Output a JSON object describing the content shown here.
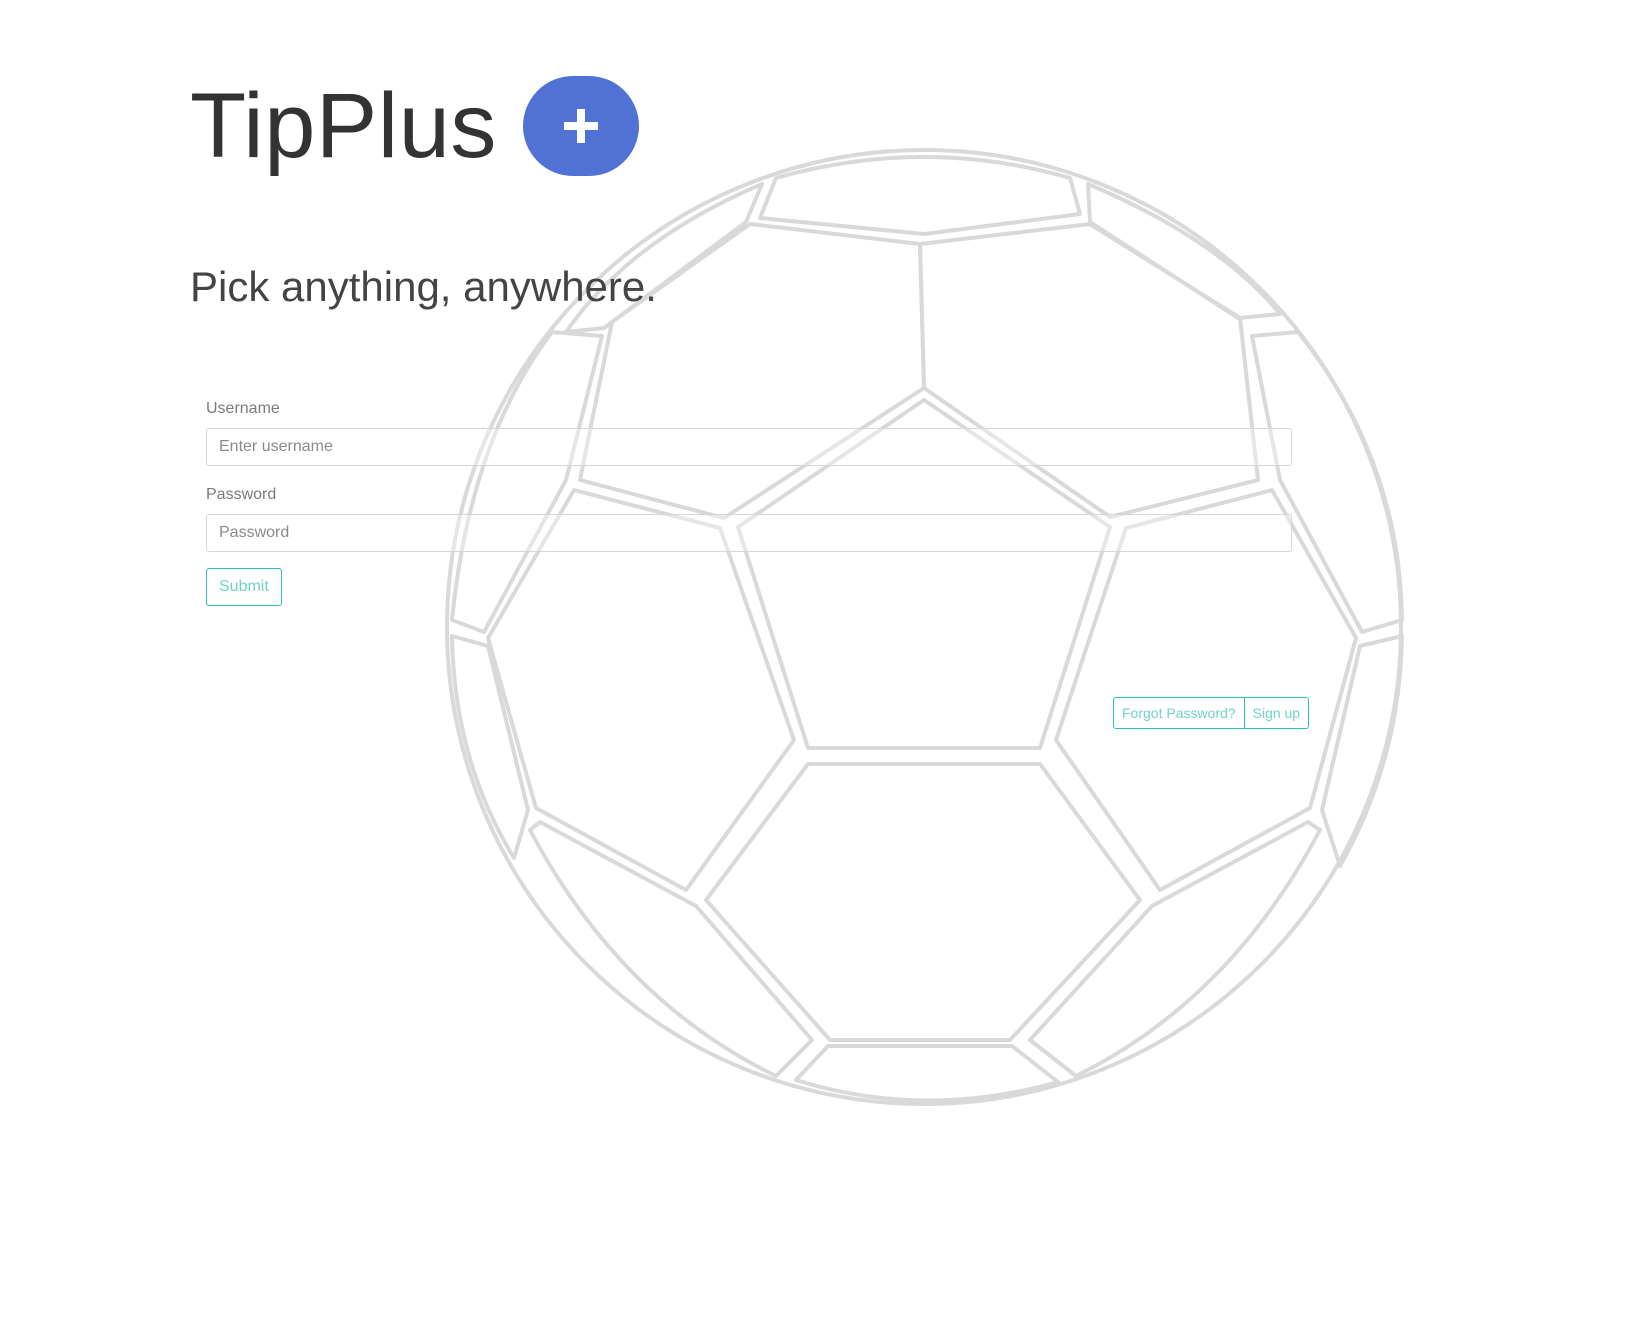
{
  "brand": {
    "name": "TipPlus",
    "badge_color": "#5072d5",
    "badge_icon": "plus-icon"
  },
  "tagline": "Pick anything, anywhere.",
  "login": {
    "username_label": "Username",
    "username_placeholder": "Enter username",
    "username_value": "",
    "password_label": "Password",
    "password_placeholder": "Password",
    "password_value": "",
    "submit_label": "Submit"
  },
  "links": {
    "forgot_label": "Forgot Password?",
    "signup_label": "Sign up"
  },
  "colors": {
    "accent": "#2bbfb0",
    "text_dark": "#333333",
    "background_art": "#d9d9d9"
  },
  "background": {
    "art_icon": "soccer-ball-icon"
  }
}
